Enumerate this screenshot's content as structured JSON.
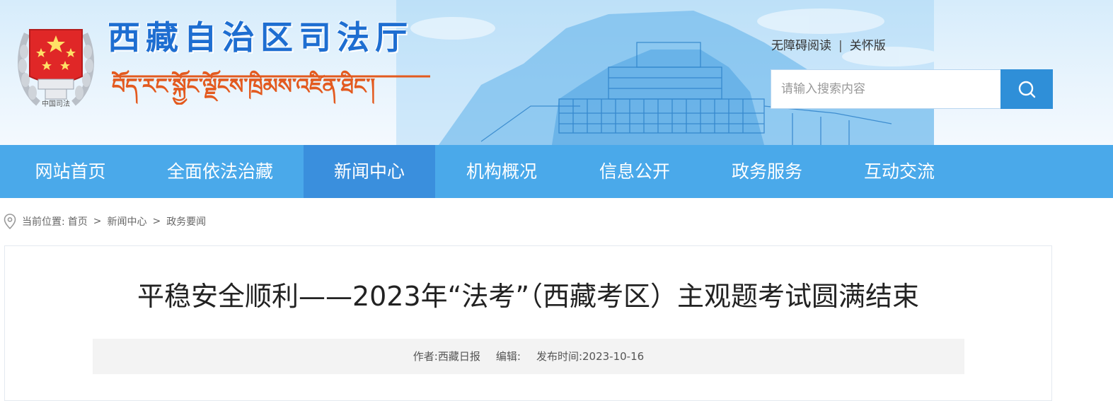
{
  "header": {
    "site_title": "西藏自治区司法厅",
    "emblem_caption": "中国司法",
    "tibetan_title": "བོད་རང་སྐྱོང་ལྗོངས་ཁྲིམས་འཛིན་ཐིང་།",
    "accessibility_link": "无障碍阅读",
    "divider": "|",
    "care_link": "关怀版",
    "search": {
      "placeholder": "请输入搜索内容",
      "value": ""
    }
  },
  "nav": {
    "items": [
      {
        "label": "网站首页",
        "active": false
      },
      {
        "label": "全面依法治藏",
        "active": false
      },
      {
        "label": "新闻中心",
        "active": true
      },
      {
        "label": "机构概况",
        "active": false
      },
      {
        "label": "信息公开",
        "active": false
      },
      {
        "label": "政务服务",
        "active": false
      },
      {
        "label": "互动交流",
        "active": false
      }
    ]
  },
  "breadcrumb": {
    "prefix": "当前位置:",
    "items": [
      "首页",
      "新闻中心",
      "政务要闻"
    ],
    "separator": ">"
  },
  "article": {
    "title": "平稳安全顺利——2023年“法考”（西藏考区）主观题考试圆满结束",
    "author_label": "作者:",
    "author": "西藏日报",
    "editor_label": "编辑:",
    "editor": "",
    "date_label": "发布时间:",
    "date": "2023-10-16"
  },
  "colors": {
    "brand_blue": "#1e6ed1",
    "nav_bg": "#4aa9ea",
    "nav_active": "#3a8fdd",
    "search_button": "#2f8fd8",
    "emblem_red": "#e02727"
  },
  "icons": [
    "emblem-icon",
    "search-icon",
    "location-pin-icon"
  ]
}
